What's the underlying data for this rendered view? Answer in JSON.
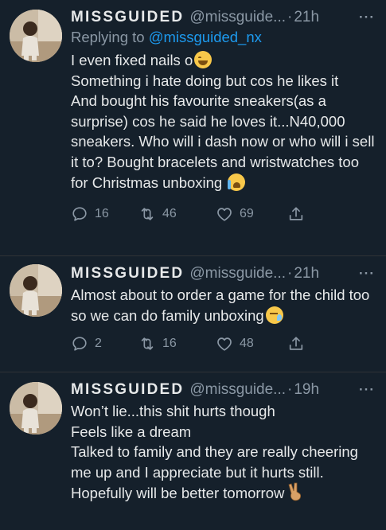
{
  "tweets": [
    {
      "name": "MISSGUIDED",
      "handle": "@missguide...",
      "sep": "·",
      "time": "21h",
      "more": "···",
      "reply_prefix": "Replying to ",
      "reply_to": "@missguided_nx",
      "lines": [
        "I even fixed nails o",
        "Something i hate doing but cos he likes it",
        "And bought his favourite sneakers(as a surprise) cos he said he loves it...N40,000 sneakers. Who will i dash now or who will i sell it to? Bought bracelets and wristwatches too for Christmas unboxing"
      ],
      "replies": "16",
      "retweets": "46",
      "likes": "69"
    },
    {
      "name": "MISSGUIDED",
      "handle": "@missguide...",
      "sep": "·",
      "time": "21h",
      "more": "···",
      "lines": [
        "Almost about to order a game for the child too so we can do family unboxing"
      ],
      "replies": "2",
      "retweets": "16",
      "likes": "48"
    },
    {
      "name": "MISSGUIDED",
      "handle": "@missguide...",
      "sep": "·",
      "time": "19h",
      "more": "···",
      "lines": [
        "Won’t lie...this shit hurts though",
        "Feels like a dream",
        "Talked to family and they are really cheering me up and I appreciate but it hurts still. Hopefully will be better tomorrow"
      ]
    }
  ],
  "icons": {
    "reply": "reply-icon",
    "retweet": "retweet-icon",
    "like": "heart-icon",
    "share": "share-icon"
  },
  "colors": {
    "background": "#15202b",
    "text": "#e7e9ea",
    "secondary": "#8b98a5",
    "link": "#1d9bf0"
  }
}
